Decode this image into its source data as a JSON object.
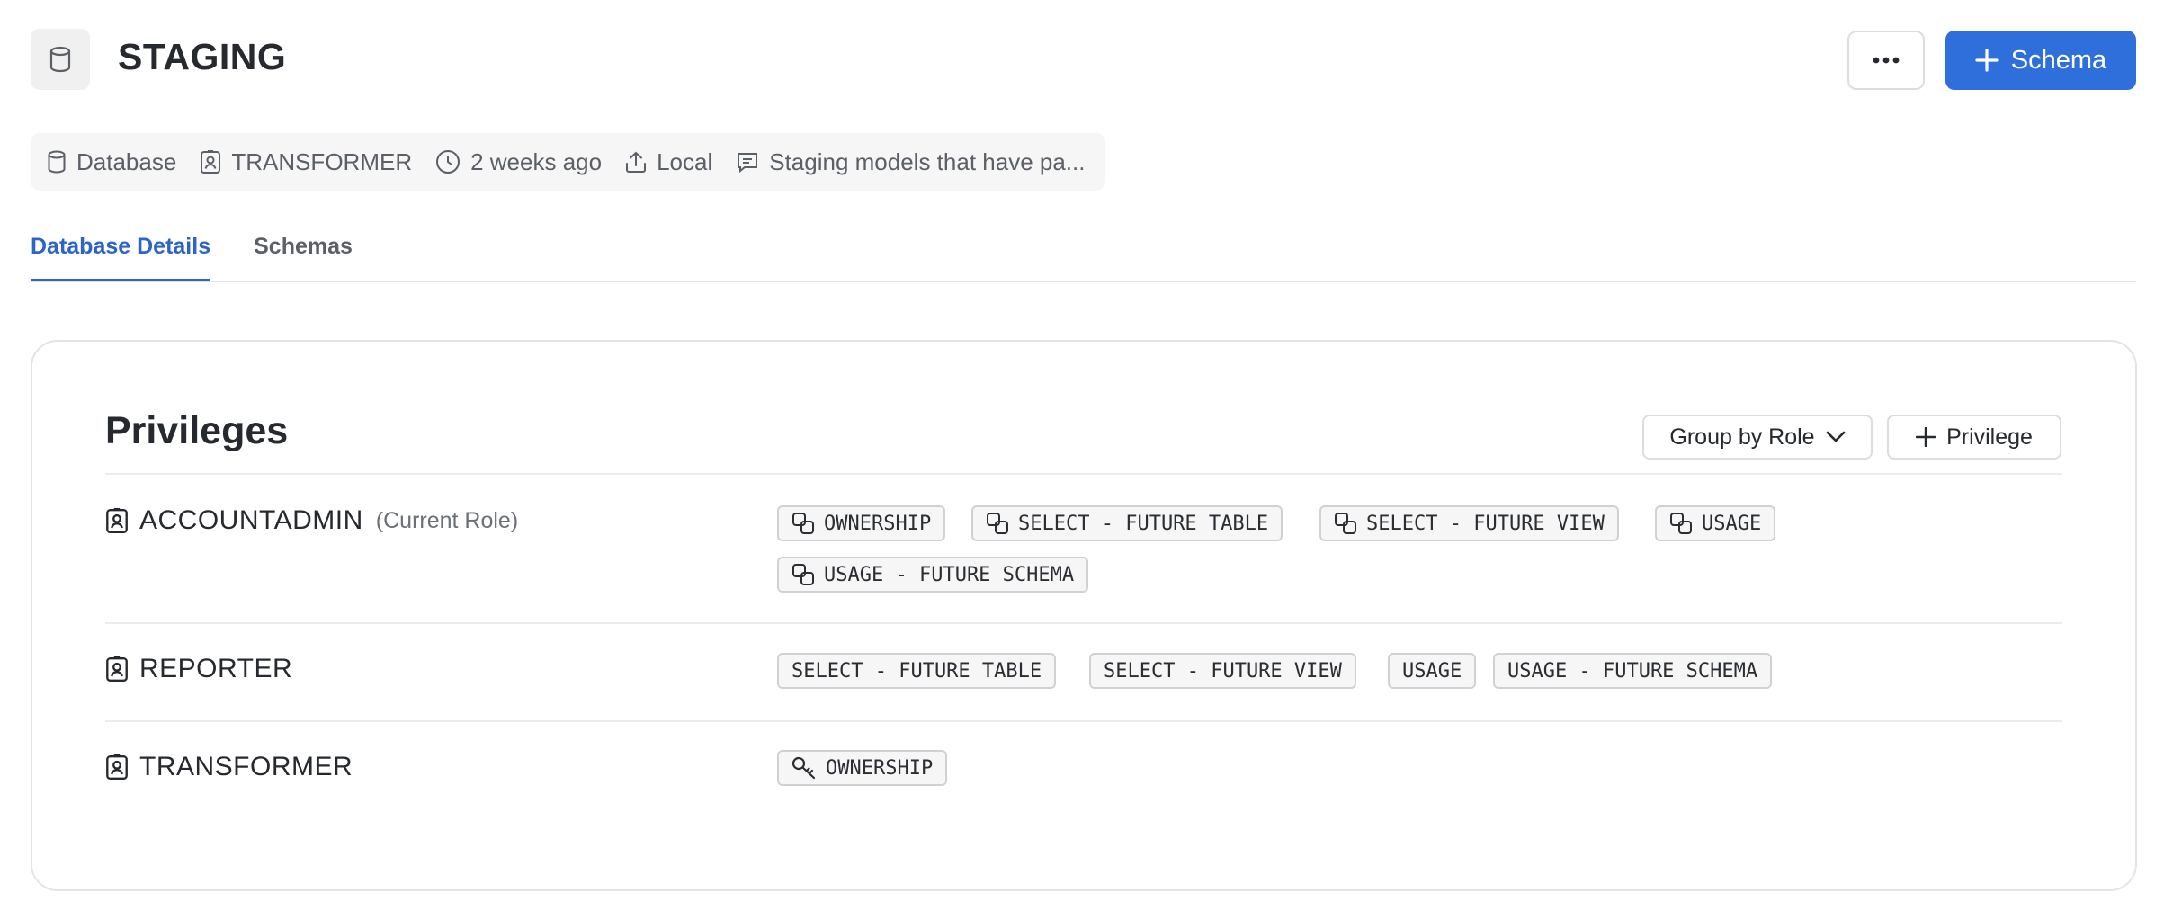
{
  "header": {
    "db_icon": "database-icon",
    "title": "STAGING",
    "more_icon": "more-horizontal-icon",
    "primary_button": {
      "icon": "plus-icon",
      "label": "Schema",
      "color": "#2f6fdb"
    }
  },
  "meta": {
    "type": "Database",
    "owner": "TRANSFORMER",
    "updated": "2 weeks ago",
    "source": "Local",
    "comment": "Staging models that have pa..."
  },
  "tabs": [
    {
      "label": "Database Details",
      "active": true
    },
    {
      "label": "Schemas",
      "active": false
    }
  ],
  "privileges": {
    "title": "Privileges",
    "group_by_label": "Group by Role",
    "add_label": "Privilege",
    "rows": [
      {
        "role": "ACCOUNTADMIN",
        "sub": "(Current Role)",
        "chips": [
          {
            "label": "OWNERSHIP",
            "icon": "inherited-grant-icon"
          },
          {
            "label": "SELECT - FUTURE TABLE",
            "icon": "inherited-grant-icon"
          },
          {
            "label": "SELECT - FUTURE VIEW",
            "icon": "inherited-grant-icon"
          },
          {
            "label": "USAGE",
            "icon": "inherited-grant-icon"
          },
          {
            "label": "USAGE - FUTURE SCHEMA",
            "icon": "inherited-grant-icon"
          }
        ]
      },
      {
        "role": "REPORTER",
        "sub": "",
        "chips": [
          {
            "label": "SELECT - FUTURE TABLE",
            "icon": ""
          },
          {
            "label": "SELECT - FUTURE VIEW",
            "icon": ""
          },
          {
            "label": "USAGE",
            "icon": ""
          },
          {
            "label": "USAGE - FUTURE SCHEMA",
            "icon": ""
          }
        ]
      },
      {
        "role": "TRANSFORMER",
        "sub": "",
        "chips": [
          {
            "label": "OWNERSHIP",
            "icon": "key-icon"
          }
        ]
      }
    ]
  },
  "colors": {
    "accent": "#2d64c8",
    "primary_button": "#2f6fdb",
    "chip_bg": "#f6f6f7",
    "chip_border": "#cfd1d4"
  }
}
